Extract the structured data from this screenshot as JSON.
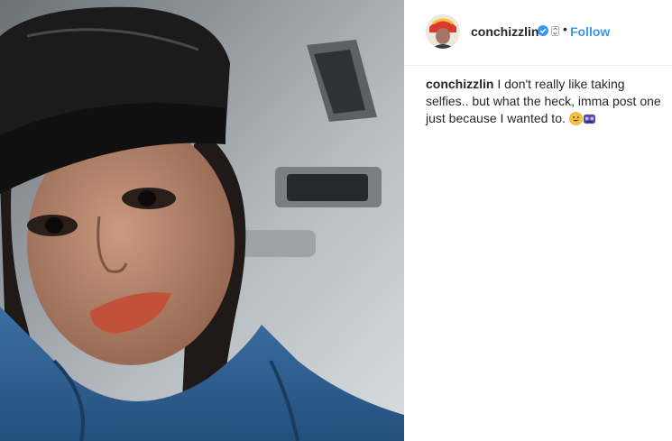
{
  "post": {
    "username": "conchizzlin",
    "follow_label": "Follow",
    "separator": "•",
    "caption_user": "conchizzlin",
    "caption_text": " I don't really like taking selfies.. but what the heck, imma post one just because I wanted to. ",
    "emojis": [
      "grinning-face-emoji",
      "purple-emoji"
    ]
  },
  "colors": {
    "follow": "#3897f0",
    "verified": "#3897f0",
    "text": "#262626"
  }
}
